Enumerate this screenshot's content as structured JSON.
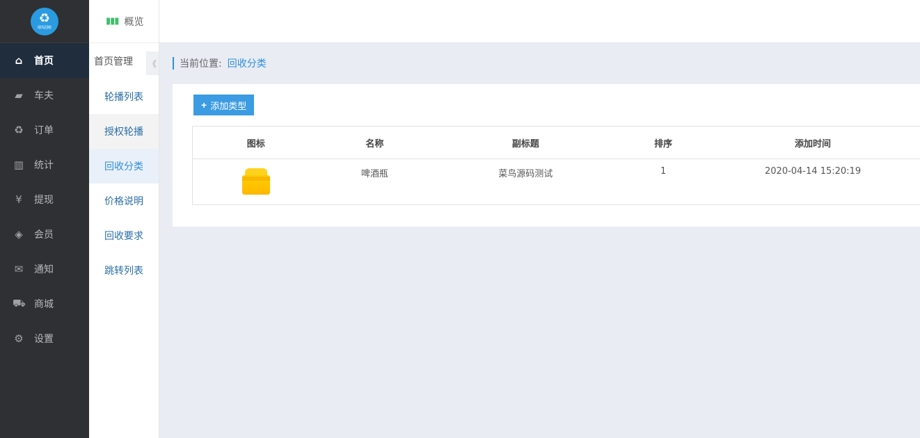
{
  "logo": {
    "text": "绿鸟回收"
  },
  "sidebar": {
    "items": [
      {
        "label": "首页",
        "icon": "home-icon",
        "glyph": "⌂"
      },
      {
        "label": "车夫",
        "icon": "truck-icon",
        "glyph": "▰"
      },
      {
        "label": "订单",
        "icon": "recycle-icon",
        "glyph": "♻"
      },
      {
        "label": "统计",
        "icon": "bar-chart-icon",
        "glyph": "▥"
      },
      {
        "label": "提现",
        "icon": "yen-icon",
        "glyph": "¥"
      },
      {
        "label": "会员",
        "icon": "tag-icon",
        "glyph": "◈"
      },
      {
        "label": "通知",
        "icon": "chat-icon",
        "glyph": "✉"
      },
      {
        "label": "商城",
        "icon": "cart-icon",
        "glyph": "⛟"
      },
      {
        "label": "设置",
        "icon": "gear-icon",
        "glyph": "⚙"
      }
    ]
  },
  "subnav": {
    "overview": "概览",
    "header": "首页管理",
    "collapse_glyph": "《",
    "items": [
      {
        "label": "轮播列表"
      },
      {
        "label": "授权轮播"
      },
      {
        "label": "回收分类"
      },
      {
        "label": "价格说明"
      },
      {
        "label": "回收要求"
      },
      {
        "label": "跳转列表"
      }
    ]
  },
  "breadcrumb": {
    "label": "当前位置:",
    "current": "回收分类"
  },
  "toolbar": {
    "add_label": "添加类型"
  },
  "table": {
    "columns": [
      "图标",
      "名称",
      "副标题",
      "排序",
      "添加时间"
    ],
    "rows": [
      {
        "icon": "box-icon",
        "name": "啤酒瓶",
        "subtitle": "菜鸟源码测试",
        "sort": "1",
        "added": "2020-04-14 15:20:19"
      }
    ]
  },
  "colors": {
    "accent": "#2f8ee0",
    "sidebar_bg": "#2e3033",
    "active_bg": "#1f2d3d",
    "button": "#3b9be3"
  }
}
